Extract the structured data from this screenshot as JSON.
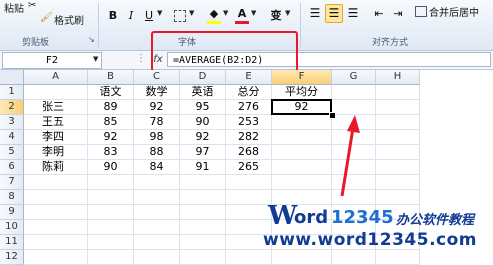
{
  "ribbon": {
    "paste_label": "粘贴",
    "format_painter_label": "格式刷",
    "bold": "B",
    "italic": "I",
    "underline": "U",
    "font_color_glyph": "A",
    "phonetic_glyph": "变",
    "merge_center_label": "合并后居中",
    "groups": {
      "clipboard": "剪贴板",
      "font": "字体",
      "alignment": "对齐方式"
    }
  },
  "formula_bar": {
    "name_box": "F2",
    "fx": "fx",
    "formula": "=AVERAGE(B2:D2)"
  },
  "sheet": {
    "columns": [
      "A",
      "B",
      "C",
      "D",
      "E",
      "F",
      "G",
      "H"
    ],
    "rows": [
      "1",
      "2",
      "3",
      "4",
      "5",
      "6",
      "7",
      "8",
      "9",
      "10",
      "11",
      "12"
    ],
    "selected_column": "F",
    "selected_row": "2",
    "cells": [
      [
        "",
        "语文",
        "数学",
        "英语",
        "总分",
        "平均分",
        "",
        ""
      ],
      [
        "张三",
        "89",
        "92",
        "95",
        "276",
        "92",
        "",
        ""
      ],
      [
        "王五",
        "85",
        "78",
        "90",
        "253",
        "",
        "",
        ""
      ],
      [
        "李四",
        "92",
        "98",
        "92",
        "282",
        "",
        "",
        ""
      ],
      [
        "李明",
        "83",
        "88",
        "97",
        "268",
        "",
        "",
        ""
      ],
      [
        "陈莉",
        "90",
        "84",
        "91",
        "265",
        "",
        "",
        ""
      ],
      [
        "",
        "",
        "",
        "",
        "",
        "",
        "",
        ""
      ],
      [
        "",
        "",
        "",
        "",
        "",
        "",
        "",
        ""
      ],
      [
        "",
        "",
        "",
        "",
        "",
        "",
        "",
        ""
      ],
      [
        "",
        "",
        "",
        "",
        "",
        "",
        "",
        ""
      ],
      [
        "",
        "",
        "",
        "",
        "",
        "",
        "",
        ""
      ],
      [
        "",
        "",
        "",
        "",
        "",
        "",
        "",
        ""
      ]
    ]
  },
  "watermark": {
    "brand_w": "W",
    "brand_ord": "ord",
    "brand_num": "12345",
    "tagline": "办公软件教程",
    "url": "www.word12345.com"
  },
  "colors": {
    "annotation_red": "#e8192c",
    "selection_header": "#f8cf78",
    "watermark_blue": "#123b93"
  }
}
